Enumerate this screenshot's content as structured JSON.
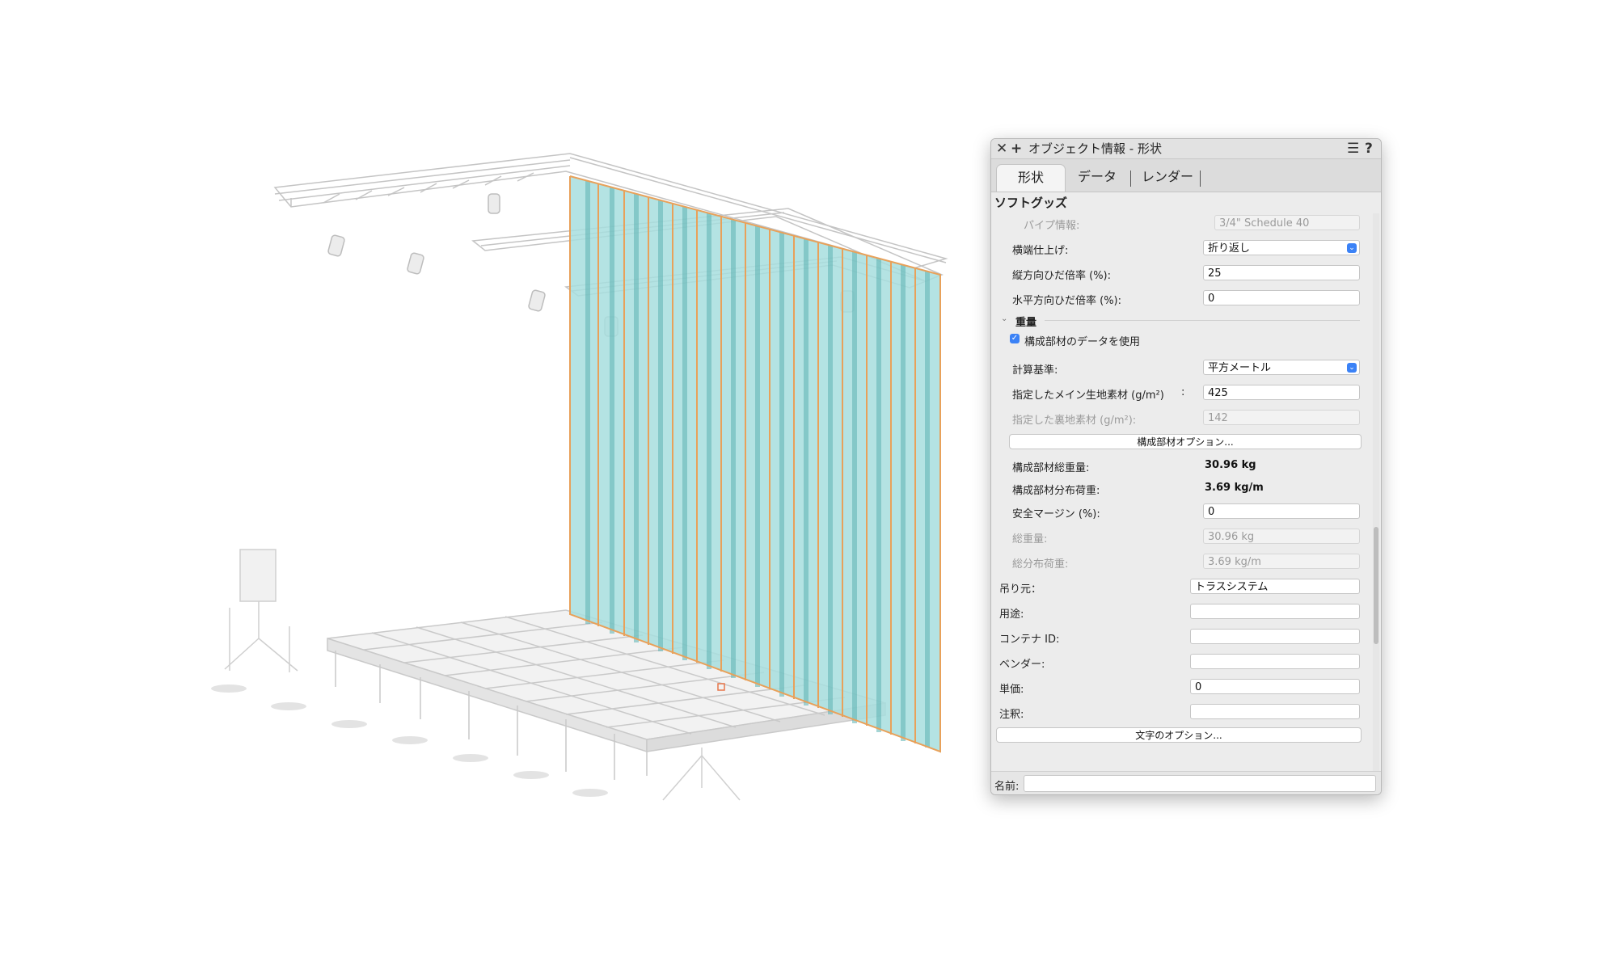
{
  "palette": {
    "title": "オブジェクト情報 - 形状",
    "tabs": [
      {
        "label": "形状",
        "active": true
      },
      {
        "label": "データ",
        "active": false
      },
      {
        "label": "レンダー",
        "active": false
      }
    ],
    "section": "ソフトグッズ",
    "pipe_info": {
      "label": "パイプ情報:",
      "value": "3/4\" Schedule 40"
    },
    "side_finish": {
      "label": "横端仕上げ:",
      "value": "折り返し"
    },
    "vertical_fullness": {
      "label": "縦方向ひだ倍率 (%):",
      "value": "25"
    },
    "horizontal_fullness": {
      "label": "水平方向ひだ倍率 (%):",
      "value": "0"
    },
    "weight_group": "重量",
    "use_component_data": {
      "label": "構成部材のデータを使用",
      "checked": true
    },
    "calc_basis": {
      "label": "計算基準:",
      "value": "平方メートル"
    },
    "main_fabric": {
      "label": "指定したメイン生地素材 (g/m²)",
      "colon": ":",
      "value": "425"
    },
    "lining_fabric": {
      "label": "指定した裏地素材 (g/m²):",
      "value": "142"
    },
    "component_options_button": "構成部材オプション...",
    "component_total_weight": {
      "label": "構成部材総重量:",
      "value": "30.96 kg"
    },
    "component_distributed_load": {
      "label": "構成部材分布荷重:",
      "value": "3.69 kg/m"
    },
    "safety_margin": {
      "label": "安全マージン (%):",
      "value": "0"
    },
    "total_weight": {
      "label": "総重量:",
      "value": "30.96 kg"
    },
    "total_distributed_load": {
      "label": "総分布荷重:",
      "value": "3.69 kg/m"
    },
    "hung_from": {
      "label": "吊り元：",
      "value": "トラスシステム"
    },
    "purpose": {
      "label": "用途:",
      "value": ""
    },
    "container_id": {
      "label": "コンテナ ID:",
      "value": ""
    },
    "vendor": {
      "label": "ベンダー:",
      "value": ""
    },
    "unit_price": {
      "label": "単価:",
      "value": "0"
    },
    "notes": {
      "label": "注釈:",
      "value": ""
    },
    "text_options_button": "文字のオプション...",
    "name": {
      "label": "名前:",
      "value": ""
    },
    "colors": {
      "accent": "#3b82f6",
      "curtain": "#8fd3d3",
      "selection": "#e8a15a"
    }
  }
}
